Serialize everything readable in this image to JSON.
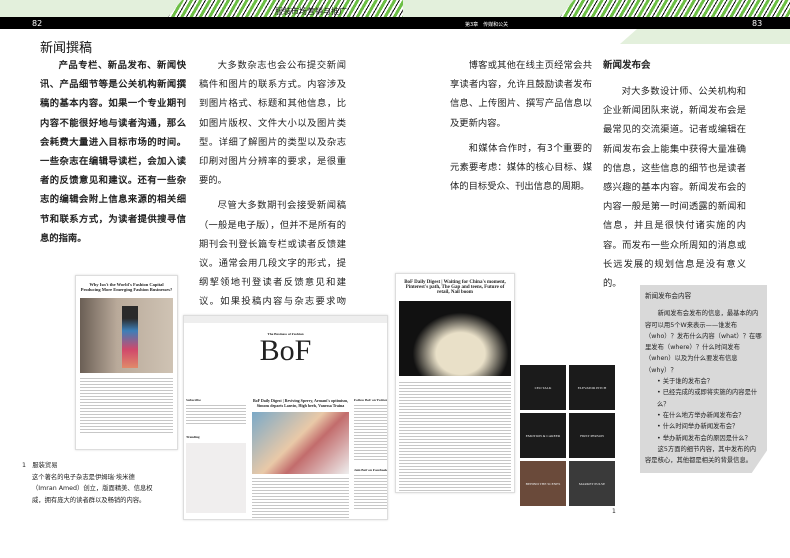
{
  "header": {
    "left_page_number": "82",
    "right_page_number": "83",
    "book_title": "服装市场营销与推广",
    "chapter": "第3章　传媒和公关"
  },
  "left": {
    "title": "新闻撰稿",
    "col1": "产品专栏、新品发布、新闻快讯、产品细节等是公关机构新闻撰稿的基本内容。如果一个专业期刊内容不能很好地与读者沟通，那么会耗费大量进入目标市场的时间。一些杂志在编辑导读栏，会加入读者的反馈意见和建议。还有一些杂志的编辑会附上信息来源的相关细节和联系方式，为读者提供搜寻信息的指南。",
    "col2_p1": "大多数杂志也会公布提交新闻稿件和图片的联系方式。内容涉及到图片格式、标题和其他信息，比如图片版权、文件大小以及图片类型。详细了解图片的类型以及杂志印刷对图片分辨率的要求，是很重要的。",
    "col2_p2": "尽管大多数期刊会接受新闻稿（一般是电子版），但并不是所有的期刊会刊登长篇专栏或读者反馈建议。通常会用几段文字的形式，提纲挈领地刊登读者反馈意见和建议。如果投稿内容与杂志要求吻合，文章就可能全文刊出。"
  },
  "right": {
    "col1_p1": "博客或其他在线主页经常会共享读者内容，允许且鼓励读者发布信息、上传图片、撰写产品信息以及更新内容。",
    "col1_p2": "和媒体合作时，有3个重要的元素要考虑：媒体的核心目标、媒体的目标受众、刊出信息的周期。",
    "col2_title": "新闻发布会",
    "col2_p1": "对大多数设计师、公关机构和企业新闻团队来说，新闻发布会是最常见的交流渠道。记者或编辑在新闻发布会上能集中获得大量准确的信息，这些信息的细节也是读者感兴趣的基本内容。新闻发布会的内容一般是第一时间透露的新闻和信息，并且是很快付诸实施的内容。而发布一些众所周知的消息或长远发展的规划信息是没有意义的。"
  },
  "sidebar": {
    "title": "新闻发布会内容",
    "intro": "新闻发布会发布的信息，最基本的内容可以用5个W来表示——谁发布（who）？发布什么内容（what）？在哪里发布（where）？什么时间发布（when）以及为什么要发布信息（why）？",
    "bullets": [
      "关于谁的发布会？",
      "已经完成的或即将实施的内容是什么？",
      "在什么地方举办新闻发布会？",
      "什么时间举办新闻发布会？",
      "举办新闻发布会的原因是什么？"
    ],
    "outro": "这5方面的细节内容，其中发布的内容是核心，其他都是相关的背景信息。"
  },
  "caption": {
    "number": "1",
    "title": "服装贸易",
    "text": "这个著名的电子杂志是伊姆瑞·埃米德（Imran Amed）创立，版面精美、信息权威，拥有庞大的读者群以及畅销的内容。"
  },
  "figure_marker": "1",
  "screenshots": {
    "article1": "Why Isn't the World's Fashion Capital Producing More Emerging Fashion Businesses?",
    "bof_header": "The Business of Fashion",
    "bof_logo": "BoF",
    "bof_digest": "BoF Daily Digest | Reviving Sperry, Armani's optimism, Simons departs Lanvin, High heels, Vanessa Traina",
    "bof_subscribe": "Subscribe",
    "bof_trending": "Trending",
    "bof_follow": "Follow BoF on Twitter",
    "bof_facebook": "Join BoF on Facebook",
    "digest2": "BoF Daily Digest | Waiting for China's moment, Pinterest's path, The Gap and teens, Future of retail, Nail boom",
    "tiles": [
      "CEO TALK",
      "ELEVATOR PITCH",
      "EMOTION & CAREER",
      "FIRST PERSON",
      "BEHIND THE SCENES",
      "MARKET PULSE"
    ]
  }
}
